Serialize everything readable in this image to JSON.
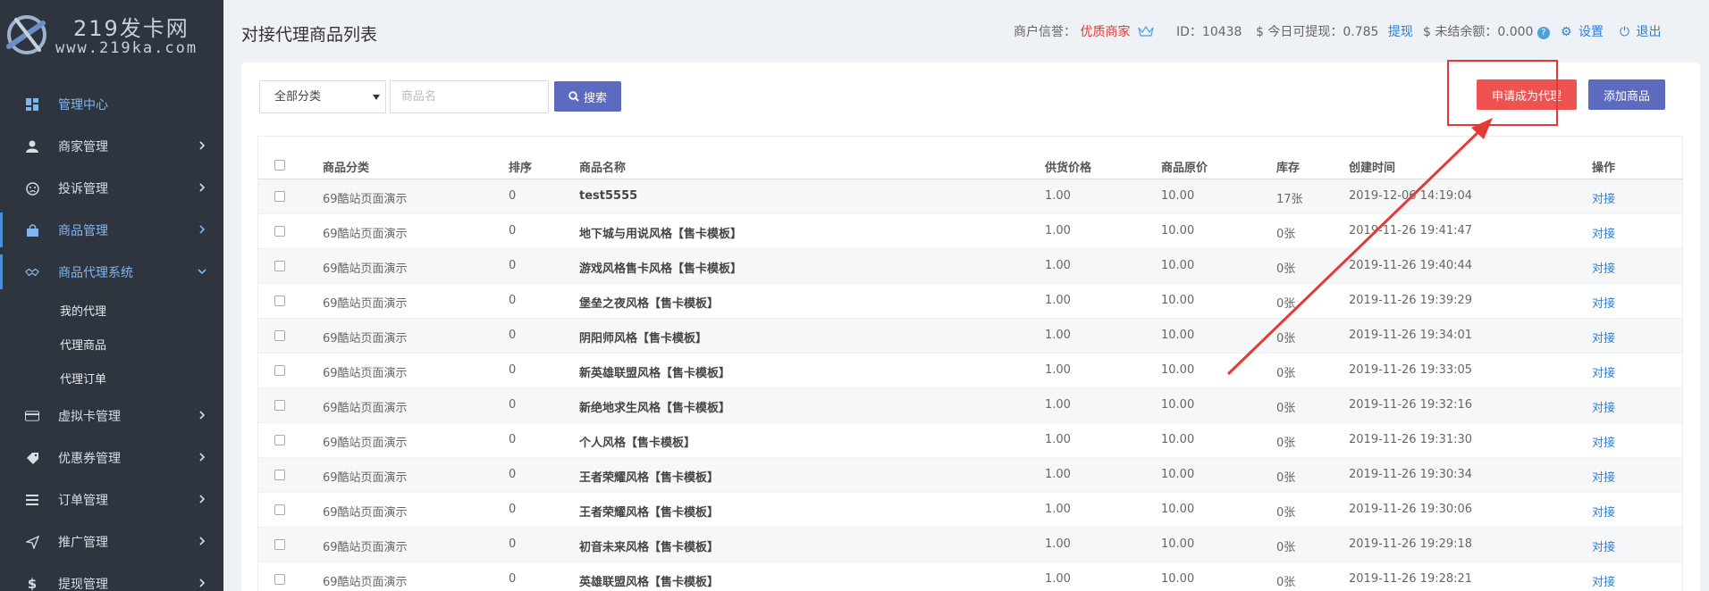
{
  "brand": {
    "title": "219发卡网",
    "subtitle": "www.219ka.com"
  },
  "sidebar": {
    "items": [
      {
        "label": "管理中心",
        "icon": "dashboard-icon",
        "highlight": true,
        "chevron": ""
      },
      {
        "label": "商家管理",
        "icon": "user-icon",
        "highlight": false,
        "chevron": "right"
      },
      {
        "label": "投诉管理",
        "icon": "complaint-icon",
        "highlight": false,
        "chevron": "right"
      },
      {
        "label": "商品管理",
        "icon": "bag-icon",
        "highlight": true,
        "chevron": "right"
      },
      {
        "label": "商品代理系统",
        "icon": "handshake-icon",
        "highlight": true,
        "chevron": "down"
      }
    ],
    "subitems": [
      {
        "label": "我的代理"
      },
      {
        "label": "代理商品"
      },
      {
        "label": "代理订单"
      }
    ],
    "items_after": [
      {
        "label": "虚拟卡管理",
        "icon": "card-icon",
        "chevron": "right"
      },
      {
        "label": "优惠券管理",
        "icon": "tag-icon",
        "chevron": "right"
      },
      {
        "label": "订单管理",
        "icon": "list-icon",
        "chevron": "right"
      },
      {
        "label": "推广管理",
        "icon": "send-icon",
        "chevron": "right"
      },
      {
        "label": "提现管理",
        "icon": "dollar-icon",
        "chevron": "right"
      }
    ]
  },
  "header": {
    "page_title": "对接代理商品列表",
    "reputation_label": "商户信誉：",
    "reputation_value": "优质商家",
    "id_text": "ID：10438",
    "withdraw_label": "$ 今日可提现：0.785",
    "withdraw_link": "提现",
    "unsettled_text": "$ 未结余额：0.000",
    "settings": "设置",
    "logout": "退出"
  },
  "filters": {
    "category_selected": "全部分类",
    "name_placeholder": "商品名",
    "search_button": "搜索"
  },
  "actions": {
    "apply_agent": "申请成为代理",
    "add_product": "添加商品"
  },
  "table": {
    "columns": [
      "商品分类",
      "排序",
      "商品名称",
      "供货价格",
      "商品原价",
      "库存",
      "创建时间",
      "操作"
    ],
    "rows": [
      {
        "category": "69酷站页面演示",
        "sort": "0",
        "name": "test5555",
        "supply": "1.00",
        "price": "10.00",
        "stock": "17张",
        "created": "2019-12-06 14:19:04",
        "action": "对接"
      },
      {
        "category": "69酷站页面演示",
        "sort": "0",
        "name": "地下城与用说风格【售卡模板】",
        "supply": "1.00",
        "price": "10.00",
        "stock": "0张",
        "created": "2019-11-26 19:41:47",
        "action": "对接"
      },
      {
        "category": "69酷站页面演示",
        "sort": "0",
        "name": "游戏风格售卡风格【售卡模板】",
        "supply": "1.00",
        "price": "10.00",
        "stock": "0张",
        "created": "2019-11-26 19:40:44",
        "action": "对接"
      },
      {
        "category": "69酷站页面演示",
        "sort": "0",
        "name": "堡垒之夜风格【售卡模板】",
        "supply": "1.00",
        "price": "10.00",
        "stock": "0张",
        "created": "2019-11-26 19:39:29",
        "action": "对接"
      },
      {
        "category": "69酷站页面演示",
        "sort": "0",
        "name": "阴阳师风格【售卡模板】",
        "supply": "1.00",
        "price": "10.00",
        "stock": "0张",
        "created": "2019-11-26 19:34:01",
        "action": "对接"
      },
      {
        "category": "69酷站页面演示",
        "sort": "0",
        "name": "新英雄联盟风格【售卡模板】",
        "supply": "1.00",
        "price": "10.00",
        "stock": "0张",
        "created": "2019-11-26 19:33:05",
        "action": "对接"
      },
      {
        "category": "69酷站页面演示",
        "sort": "0",
        "name": "新绝地求生风格【售卡模板】",
        "supply": "1.00",
        "price": "10.00",
        "stock": "0张",
        "created": "2019-11-26 19:32:16",
        "action": "对接"
      },
      {
        "category": "69酷站页面演示",
        "sort": "0",
        "name": "个人风格【售卡模板】",
        "supply": "1.00",
        "price": "10.00",
        "stock": "0张",
        "created": "2019-11-26 19:31:30",
        "action": "对接"
      },
      {
        "category": "69酷站页面演示",
        "sort": "0",
        "name": "王者荣耀风格【售卡模板】",
        "supply": "1.00",
        "price": "10.00",
        "stock": "0张",
        "created": "2019-11-26 19:30:34",
        "action": "对接"
      },
      {
        "category": "69酷站页面演示",
        "sort": "0",
        "name": "王者荣耀风格【售卡模板】",
        "supply": "1.00",
        "price": "10.00",
        "stock": "0张",
        "created": "2019-11-26 19:30:06",
        "action": "对接"
      },
      {
        "category": "69酷站页面演示",
        "sort": "0",
        "name": "初音未来风格【售卡模板】",
        "supply": "1.00",
        "price": "10.00",
        "stock": "0张",
        "created": "2019-11-26 19:29:18",
        "action": "对接"
      },
      {
        "category": "69酷站页面演示",
        "sort": "0",
        "name": "英雄联盟风格【售卡模板】",
        "supply": "1.00",
        "price": "10.00",
        "stock": "0张",
        "created": "2019-11-26 19:28:21",
        "action": "对接"
      }
    ]
  },
  "colors": {
    "sidebar_bg": "#2f353f",
    "accent_red": "#ef5350",
    "accent_indigo": "#5c6bc0",
    "link_blue": "#2d7fd6"
  }
}
